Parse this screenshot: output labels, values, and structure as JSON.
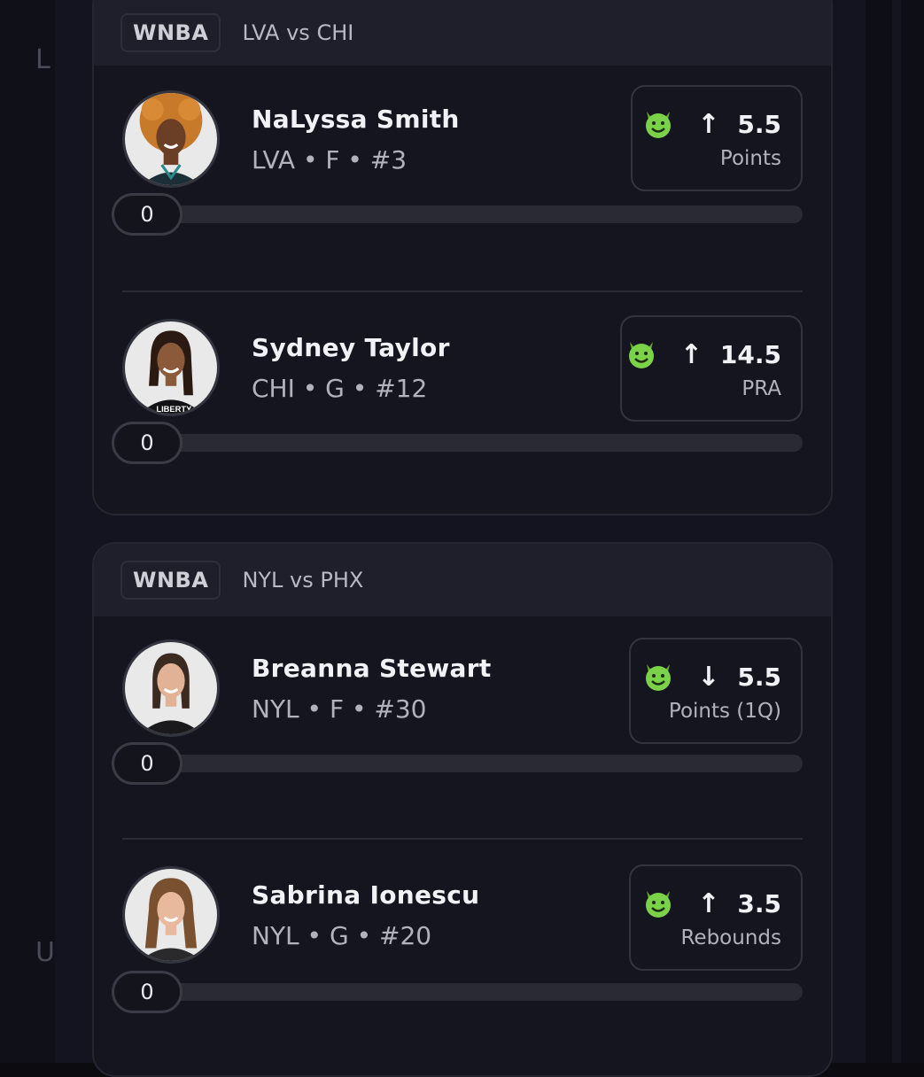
{
  "games": [
    {
      "league": "WNBA",
      "matchup": "LVA vs CHI",
      "players": [
        {
          "name": "NaLyssa Smith",
          "meta": "LVA • F • #3",
          "direction_icon": "↑",
          "line": "5.5",
          "stat": "Points",
          "progress": "0"
        },
        {
          "name": "Sydney Taylor",
          "meta": "CHI • G • #12",
          "direction_icon": "↑",
          "line": "14.5",
          "stat": "PRA",
          "progress": "0"
        }
      ]
    },
    {
      "league": "WNBA",
      "matchup": "NYL vs PHX",
      "players": [
        {
          "name": "Breanna Stewart",
          "meta": "NYL • F • #30",
          "direction_icon": "↓",
          "line": "5.5",
          "stat": "Points (1Q)",
          "progress": "0"
        },
        {
          "name": "Sabrina Ionescu",
          "meta": "NYL • G • #20",
          "direction_icon": "↑",
          "line": "3.5",
          "stat": "Rebounds",
          "progress": "0"
        }
      ]
    }
  ],
  "colors": {
    "background": "#0b0b10",
    "card": "#15151f",
    "header": "#1f1f2b",
    "devil_green": "#7bd148",
    "text": "#f1f1f6",
    "muted": "#b2b2be"
  },
  "icons": {
    "pick_badge": "devil-emoji-icon"
  }
}
